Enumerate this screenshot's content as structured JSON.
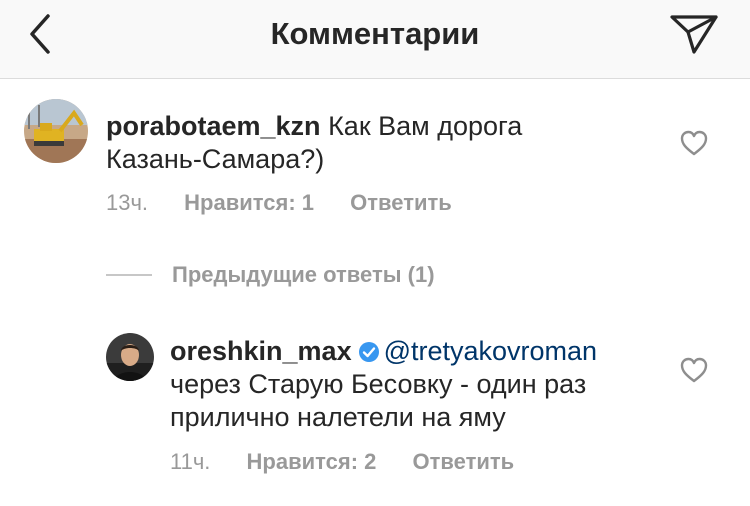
{
  "header": {
    "title": "Комментарии"
  },
  "comments": [
    {
      "username": "porabotaem_kzn",
      "text_line1": "Как Вам дорога",
      "text_line2": "Казань-Самара?)",
      "time": "13ч.",
      "likes": "Нравится: 1",
      "reply": "Ответить"
    }
  ],
  "replies_toggle": {
    "label": "Предыдущие ответы (1)"
  },
  "replies": [
    {
      "username": "oreshkin_max",
      "mention": "@tretyakovroman",
      "text_line2": "через Старую Бесовку - один раз",
      "text_line3": "прилично налетели на яму",
      "time": "11ч.",
      "likes": "Нравится: 2",
      "reply": "Ответить"
    }
  ],
  "icons": {
    "back": "chevron-left-icon",
    "send": "paper-plane-icon",
    "heart": "heart-outline-icon",
    "verified": "verified-badge-icon"
  },
  "colors": {
    "text": "#262626",
    "meta": "#999999",
    "mention": "#003569",
    "verified": "#3897f0"
  }
}
